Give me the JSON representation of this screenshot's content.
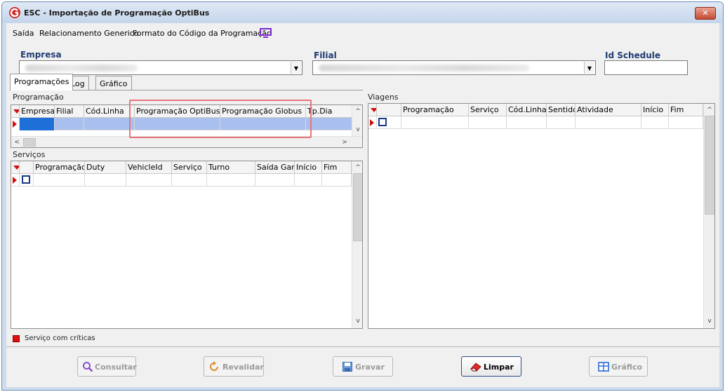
{
  "window": {
    "title": "ESC - Importação de Programação OptiBus",
    "close_label": "✕"
  },
  "menu": [
    {
      "label": "Saída"
    },
    {
      "label": "Relacionamento Generico"
    },
    {
      "label": "Formato do Código da Programação"
    }
  ],
  "filters": {
    "empresa_label": "Empresa",
    "filial_label": "Filial",
    "id_schedule_label": "Id Schedule",
    "id_schedule_value": ""
  },
  "tabs": [
    {
      "label": "Programações",
      "active": true
    },
    {
      "label": "Log",
      "active": false
    },
    {
      "label": "Gráfico",
      "active": false
    }
  ],
  "programacao": {
    "label": "Programação",
    "columns": [
      "Empresa",
      "Filial",
      "Cód.Linha",
      "Programação OptiBus",
      "Programação Globus",
      "Tp.Dia"
    ],
    "highlight_color": "#e8757a",
    "selected_row_color": "#a9c0ee"
  },
  "servicos": {
    "label": "Serviços",
    "columns": [
      "Programação",
      "Duty",
      "VehicleId",
      "Serviço",
      "Turno",
      "Saída Gar.",
      "Início",
      "Fim"
    ]
  },
  "viagens": {
    "label": "Viagens",
    "columns": [
      "Programação",
      "Serviço",
      "Cód.Linha",
      "Sentido",
      "Atividade",
      "Início",
      "Fim"
    ]
  },
  "legend": {
    "text": "Serviço com críticas",
    "color": "#e01010"
  },
  "buttons": {
    "consultar": "Consultar",
    "revalidar": "Revalidar",
    "gravar": "Gravar",
    "limpar": "Limpar",
    "grafico": "Gráfico"
  }
}
